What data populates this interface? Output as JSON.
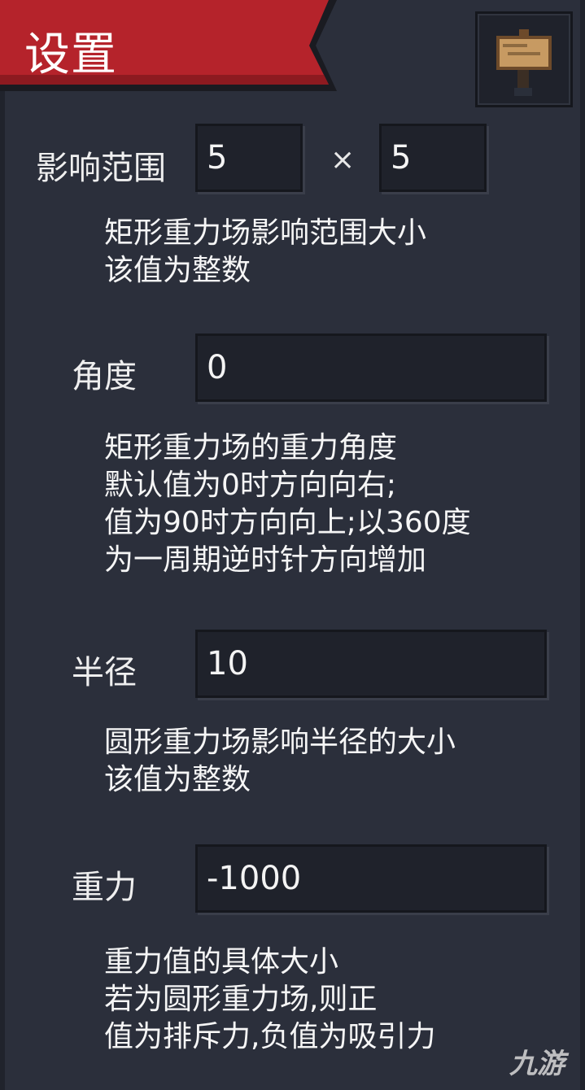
{
  "header": {
    "title": "设置",
    "icon": "signpost-icon"
  },
  "range": {
    "label": "影响范围",
    "width": "5",
    "separator": "×",
    "height": "5",
    "desc": [
      "矩形重力场影响范围大小",
      "该值为整数"
    ]
  },
  "angle": {
    "label": "角度",
    "value": "0",
    "desc": [
      "矩形重力场的重力角度",
      "默认值为0时方向向右;",
      "值为90时方向向上;以360度",
      "为一周期逆时针方向增加"
    ]
  },
  "radius": {
    "label": "半径",
    "value": "10",
    "desc": [
      "圆形重力场影响半径的大小",
      "该值为整数"
    ]
  },
  "gravity": {
    "label": "重力",
    "value": "-1000",
    "desc": [
      "重力值的具体大小",
      "若为圆形重力场,则正",
      "值为排斥力,负值为吸引力"
    ]
  },
  "watermark": "九游",
  "colors": {
    "accent_red": "#b5232b",
    "panel_bg": "#2b2f3b",
    "input_bg": "#1f222b"
  }
}
